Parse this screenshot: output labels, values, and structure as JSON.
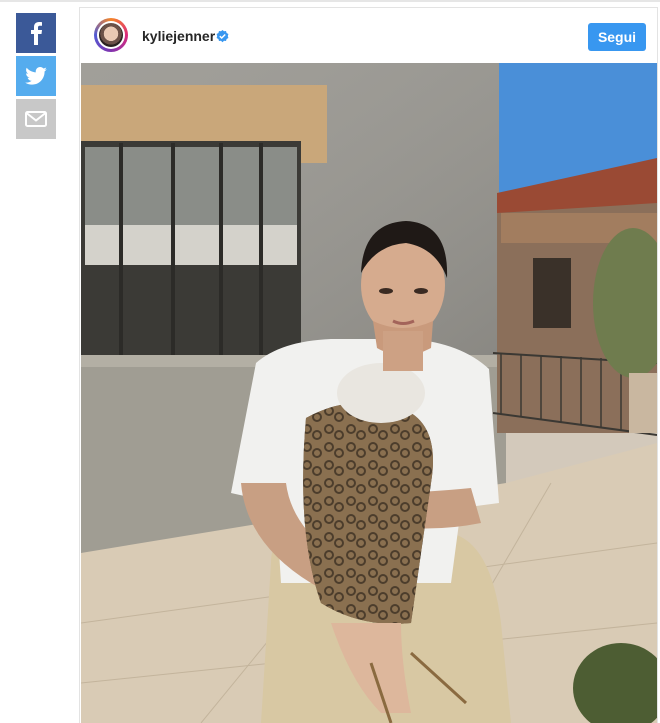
{
  "share": {
    "facebook_icon": "facebook-f-icon",
    "twitter_icon": "twitter-bird-icon",
    "email_icon": "envelope-icon",
    "facebook_color": "#3b5998",
    "twitter_color": "#55acee",
    "email_color": "#c8c8c8"
  },
  "post": {
    "username": "kyliejenner",
    "verified_icon": "verified-badge-icon",
    "follow_label": "Segui",
    "follow_color": "#3897f0"
  }
}
